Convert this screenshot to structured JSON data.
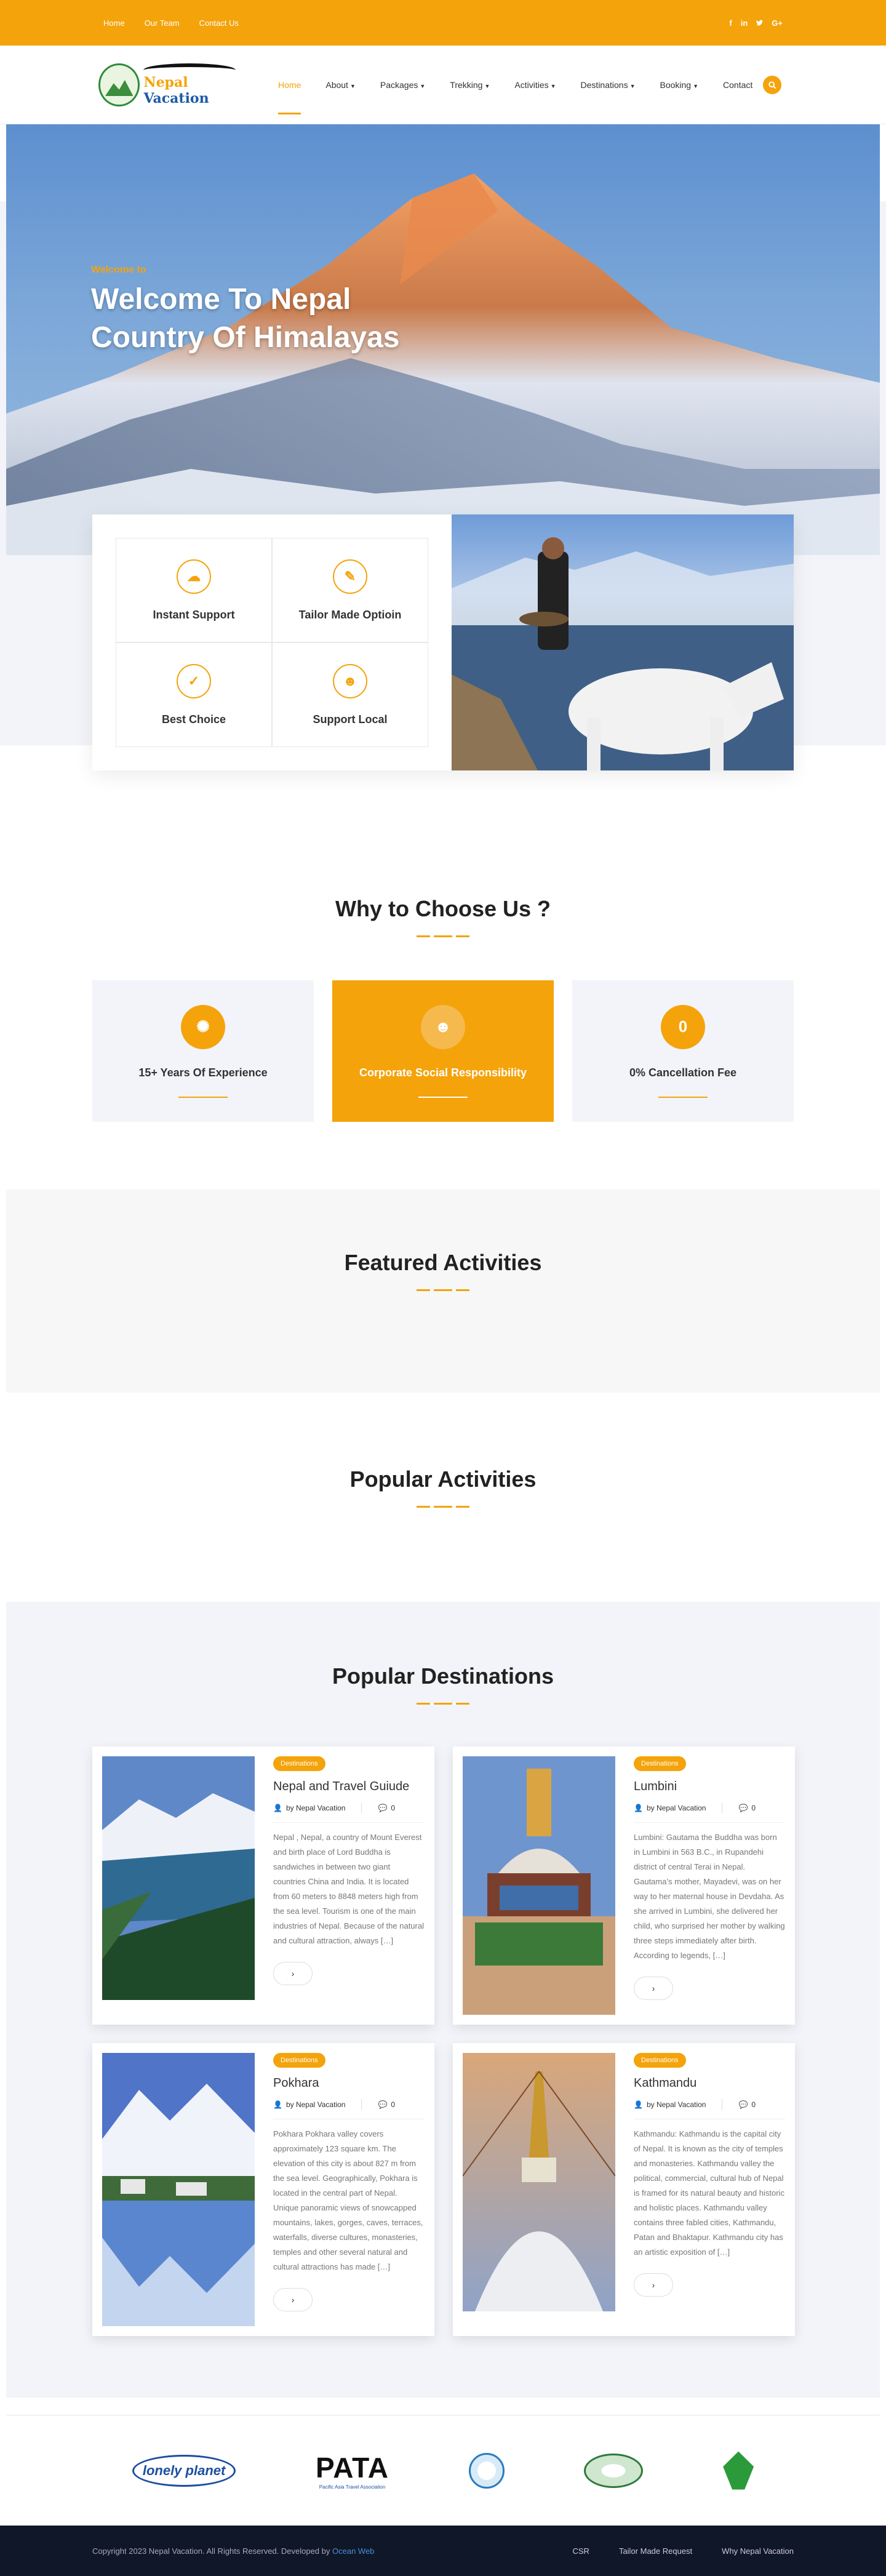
{
  "topbar": {
    "links": [
      "Home",
      "Our Team",
      "Contact Us"
    ],
    "social": [
      "f",
      "in",
      "t",
      "G+"
    ]
  },
  "header": {
    "logo_name_1": "Nepal",
    "logo_name_2": "Vacation",
    "nav": [
      {
        "label": "Home"
      },
      {
        "label": "About"
      },
      {
        "label": "Packages"
      },
      {
        "label": "Trekking"
      },
      {
        "label": "Activities"
      },
      {
        "label": "Destinations"
      },
      {
        "label": "Booking"
      },
      {
        "label": "Contact"
      }
    ]
  },
  "hero": {
    "subtitle": "Welcome to",
    "title": "Welcome To Nepal Country Of Himalayas"
  },
  "features": [
    {
      "title": "Instant Support",
      "icon": "chat-icon",
      "glyph": "☁"
    },
    {
      "title": "Tailor Made Optioin",
      "icon": "edit-icon",
      "glyph": "✎"
    },
    {
      "title": "Best Choice",
      "icon": "check-icon",
      "glyph": "✓"
    },
    {
      "title": "Support Local",
      "icon": "users-icon",
      "glyph": "☻"
    }
  ],
  "why": {
    "title": "Why to Choose Us ?",
    "cards": [
      {
        "title": "15+ Years Of Experience",
        "glyph": "✺"
      },
      {
        "title": "Corporate Social Responsibility",
        "glyph": "☻"
      },
      {
        "title": "0% Cancellation Fee",
        "glyph": "0"
      }
    ]
  },
  "featured": {
    "title": "Featured Activities"
  },
  "popular_activities": {
    "title": "Popular Activities"
  },
  "destinations": {
    "title": "Popular Destinations",
    "cards": [
      {
        "badge": "Destinations",
        "title": "Nepal and Travel Guiude",
        "author": "by Nepal Vacation",
        "comments": "0",
        "excerpt": "Nepal , Nepal, a country of Mount Everest and birth place of Lord Buddha is sandwiches in between two giant countries China and India. It is located from 60 meters to 8848 meters high from the sea level. Tourism is one of the main industries of Nepal. Because of the natural and cultural attraction, always […]"
      },
      {
        "badge": "Destinations",
        "title": "Lumbini",
        "author": "by Nepal Vacation",
        "comments": "0",
        "excerpt": "Lumbini: Gautama the Buddha was born in Lumbini in 563 B.C., in Rupandehi district of central Terai in Nepal. Gautama’s mother, Mayadevi, was on her way to her maternal house in Devdaha. As she arrived in Lumbini, she delivered her child, who surprised her mother by walking three steps immediately after birth. According to legends, […]"
      },
      {
        "badge": "Destinations",
        "title": "Pokhara",
        "author": "by Nepal Vacation",
        "comments": "0",
        "excerpt": "Pokhara Pokhara valley covers approximately 123 square km. The elevation of this city is about 827 m from the sea level. Geographically, Pokhara is located in the central part of Nepal. Unique panoramic views of snowcapped mountains, lakes, gorges, caves, terraces, waterfalls, diverse cultures, monasteries, temples and other several natural and cultural attractions has made […]"
      },
      {
        "badge": "Destinations",
        "title": "Kathmandu",
        "author": "by Nepal Vacation",
        "comments": "0",
        "excerpt": "Kathmandu: Kathmandu is the capital city of Nepal. It is known as the city of temples and monasteries. Kathmandu valley the political, commercial, cultural hub of Nepal is framed for its natural beauty and historic and holistic places. Kathmandu valley contains three fabled cities, Kathmandu, Patan and Bhaktapur. Kathmandu city has an artistic exposition of […]"
      }
    ]
  },
  "partners": [
    "lonely planet",
    "PATA",
    "Pacific Asia Travel Association"
  ],
  "footer": {
    "copyright": "Copyright 2023 Nepal Vacation. All Rights Reserved. Developed by",
    "developer": "Ocean Web",
    "links": [
      "CSR",
      "Tailor Made Request",
      "Why Nepal Vacation"
    ]
  },
  "colors": {
    "accent": "#f4a30b",
    "footer_bg": "#101728",
    "section_bg": "#f2f4f9"
  }
}
